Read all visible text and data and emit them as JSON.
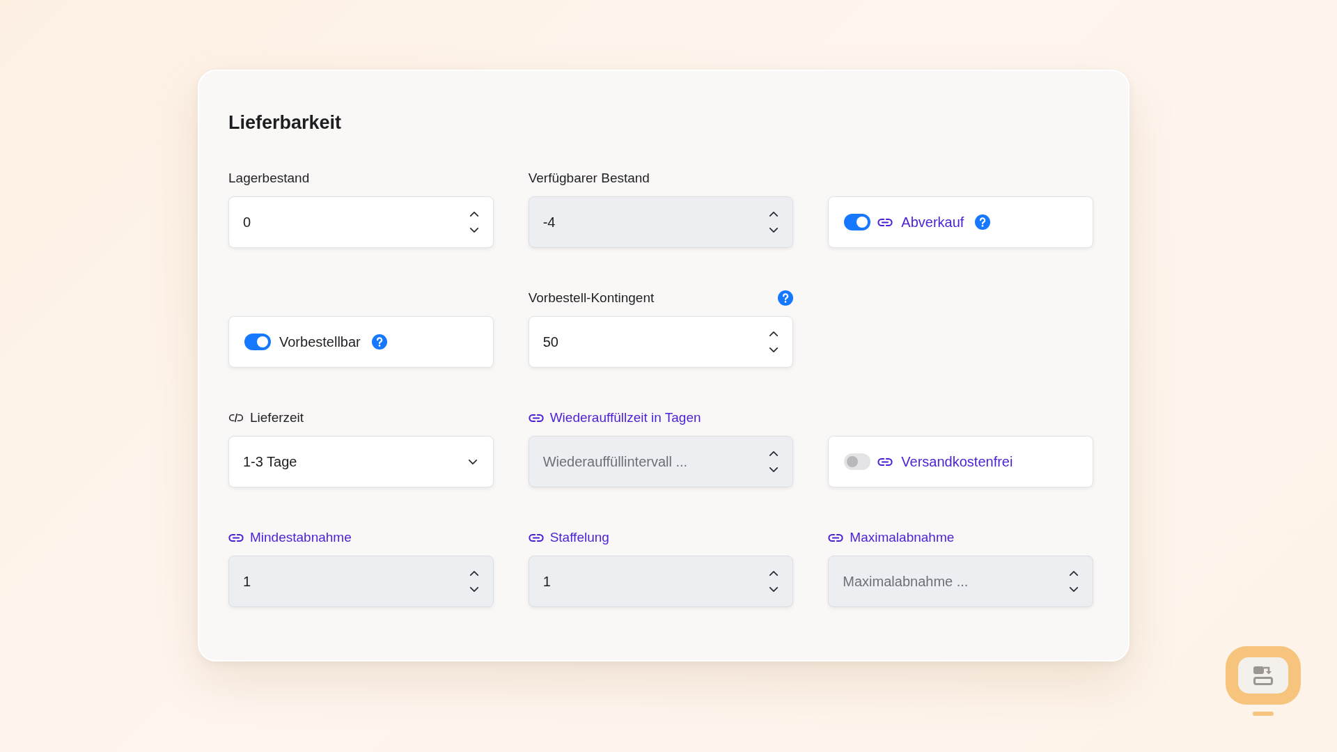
{
  "card": {
    "title": "Lieferbarkeit",
    "rows": [
      {
        "fields": [
          {
            "kind": "number",
            "label": "Lagerbestand",
            "value": "0",
            "disabled": false
          },
          {
            "kind": "number",
            "label": "Verfügbarer Bestand",
            "value": "-4",
            "disabled": true
          },
          {
            "kind": "toggle",
            "label": "Abverkauf",
            "on": true,
            "linked": true,
            "help": true
          }
        ]
      },
      {
        "fields": [
          {
            "kind": "toggle",
            "label": "Vorbestellbar",
            "on": true,
            "help": true
          },
          {
            "kind": "number",
            "label": "Vorbestell-Kontingent",
            "value": "50",
            "disabled": false,
            "help": true
          }
        ]
      },
      {
        "fields": [
          {
            "kind": "select",
            "label": "Lieferzeit",
            "value": "1-3 Tage",
            "linked": false
          },
          {
            "kind": "number",
            "label": "Wiederauffüllzeit in Tagen",
            "placeholder": "Wiederauffüllintervall ...",
            "disabled": true,
            "linked": true
          },
          {
            "kind": "toggle",
            "label": "Versandkostenfrei",
            "on": false,
            "linked": true
          }
        ]
      },
      {
        "fields": [
          {
            "kind": "number",
            "label": "Mindestabnahme",
            "value": "1",
            "disabled": true,
            "linked": true
          },
          {
            "kind": "number",
            "label": "Staffelung",
            "value": "1",
            "disabled": true,
            "linked": true
          },
          {
            "kind": "number",
            "label": "Maximalabnahme",
            "placeholder": "Maximalabnahme ...",
            "disabled": true,
            "linked": true
          }
        ]
      }
    ]
  }
}
